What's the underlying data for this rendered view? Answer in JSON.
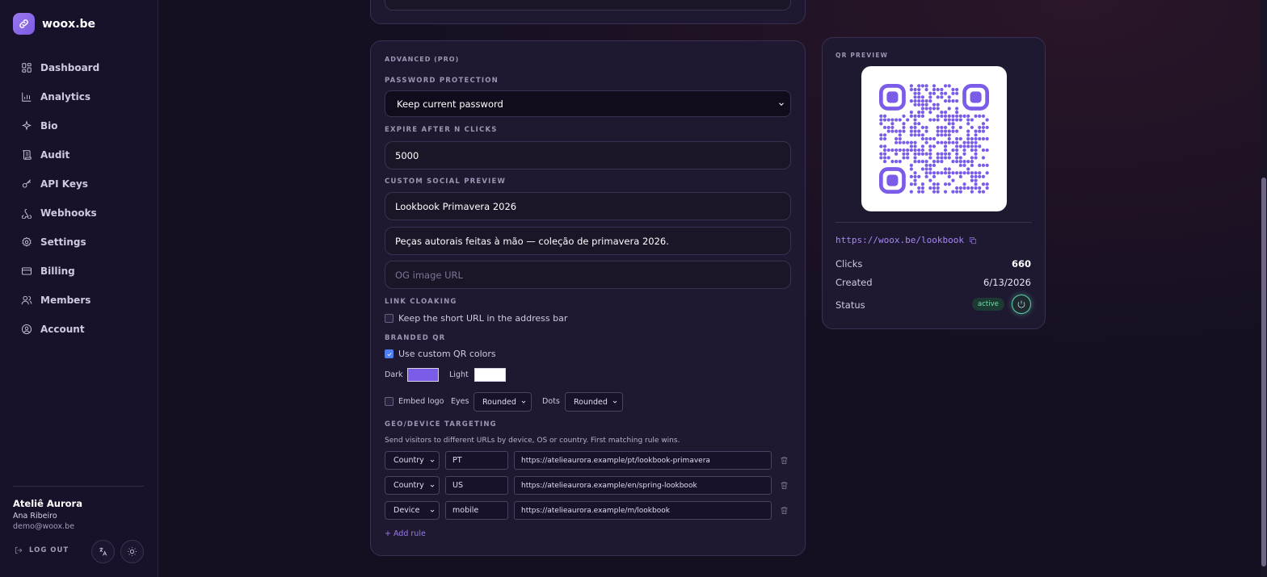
{
  "brand": {
    "name": "woox.be"
  },
  "sidebar": {
    "items": [
      {
        "label": "Dashboard",
        "icon": "dashboard-icon"
      },
      {
        "label": "Analytics",
        "icon": "bar-chart-icon"
      },
      {
        "label": "Bio",
        "icon": "sparkle-icon"
      },
      {
        "label": "Audit",
        "icon": "scroll-icon"
      },
      {
        "label": "API Keys",
        "icon": "key-icon"
      },
      {
        "label": "Webhooks",
        "icon": "webhook-icon"
      },
      {
        "label": "Settings",
        "icon": "gear-icon"
      },
      {
        "label": "Billing",
        "icon": "card-icon"
      },
      {
        "label": "Members",
        "icon": "users-icon"
      },
      {
        "label": "Account",
        "icon": "user-circle-icon"
      }
    ]
  },
  "user": {
    "org": "Ateliê Aurora",
    "name": "Ana Ribeiro",
    "email": "demo@woox.be",
    "logout_label": "LOG OUT"
  },
  "advanced": {
    "section_title": "ADVANCED (PRO)",
    "password": {
      "label": "PASSWORD PROTECTION",
      "selected": "Keep current password"
    },
    "expire": {
      "label": "EXPIRE AFTER N CLICKS",
      "value": "5000"
    },
    "social": {
      "label": "CUSTOM SOCIAL PREVIEW",
      "title_value": "Lookbook Primavera 2026",
      "description_value": "Peças autorais feitas à mão — coleção de primavera 2026.",
      "image_placeholder": "OG image URL"
    },
    "cloaking": {
      "label": "LINK CLOAKING",
      "checkbox_label": "Keep the short URL in the address bar",
      "checked": false
    },
    "branded_qr": {
      "label": "BRANDED QR",
      "checkbox_label": "Use custom QR colors",
      "checked": true,
      "dark_label": "Dark",
      "dark_color": "#7b5ce8",
      "light_label": "Light",
      "light_color": "#ffffff",
      "embed_logo_label": "Embed logo",
      "eyes_label": "Eyes",
      "eyes_value": "Rounded",
      "dots_label": "Dots",
      "dots_value": "Rounded"
    },
    "geo": {
      "label": "GEO/DEVICE TARGETING",
      "description": "Send visitors to different URLs by device, OS or country. First matching rule wins.",
      "rules": [
        {
          "type": "Country",
          "value": "PT",
          "url": "https://atelieaurora.example/pt/lookbook-primavera"
        },
        {
          "type": "Country",
          "value": "US",
          "url": "https://atelieaurora.example/en/spring-lookbook"
        },
        {
          "type": "Device",
          "value": "mobile",
          "url": "https://atelieaurora.example/m/lookbook"
        }
      ],
      "add_rule_label": "+ Add rule"
    }
  },
  "qr_preview": {
    "title": "QR PREVIEW",
    "short_url": "https://woox.be/lookbook",
    "qr_color": "#7b5ce8",
    "stats": {
      "clicks_label": "Clicks",
      "clicks_value": "660",
      "created_label": "Created",
      "created_value": "6/13/2026",
      "status_label": "Status",
      "status_value": "active"
    }
  }
}
